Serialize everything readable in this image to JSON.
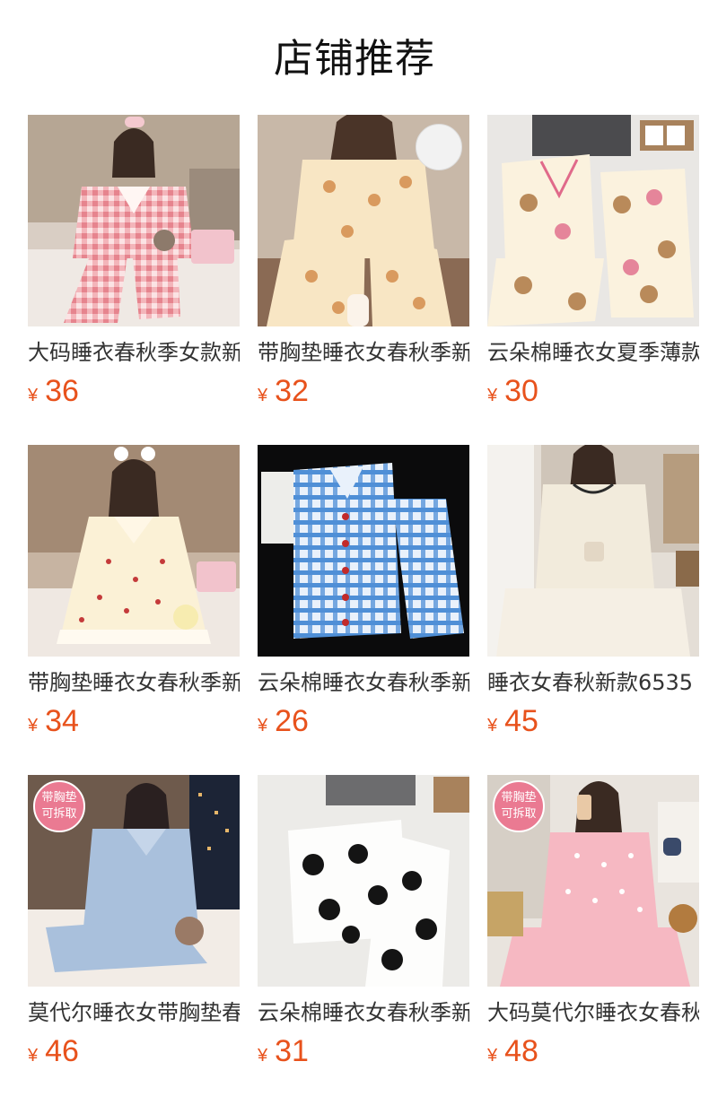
{
  "header": {
    "title": "店铺推荐"
  },
  "currency_symbol": "¥",
  "products": [
    {
      "name": "大码睡衣春秋季女款新款",
      "price": "36",
      "image": "pink-gingham-pajamas-photo"
    },
    {
      "name": "带胸垫睡衣女春秋季新款",
      "price": "32",
      "image": "cream-bear-print-pajamas-photo"
    },
    {
      "name": "云朵棉睡衣女夏季薄款",
      "price": "30",
      "image": "cream-bear-pajamas-flatlay-photo"
    },
    {
      "name": "带胸垫睡衣女春秋季新款",
      "price": "34",
      "image": "cherry-print-nightdress-photo"
    },
    {
      "name": "云朵棉睡衣女春秋季新款",
      "price": "26",
      "image": "blue-plaid-pajamas-flatlay-photo"
    },
    {
      "name": "睡衣女春秋新款6535",
      "price": "45",
      "image": "cream-knit-pajamas-photo"
    },
    {
      "name": "莫代尔睡衣女带胸垫春秋",
      "price": "46",
      "image": "light-blue-pajamas-photo"
    },
    {
      "name": "云朵棉睡衣女春秋季新款",
      "price": "31",
      "image": "black-white-cat-pajamas-flatlay-photo"
    },
    {
      "name": "大码莫代尔睡衣女春秋季",
      "price": "48",
      "image": "pink-dot-pajamas-photo"
    }
  ],
  "badges": {
    "padded_bra": {
      "line1": "带胸垫",
      "line2": "可拆取"
    }
  }
}
